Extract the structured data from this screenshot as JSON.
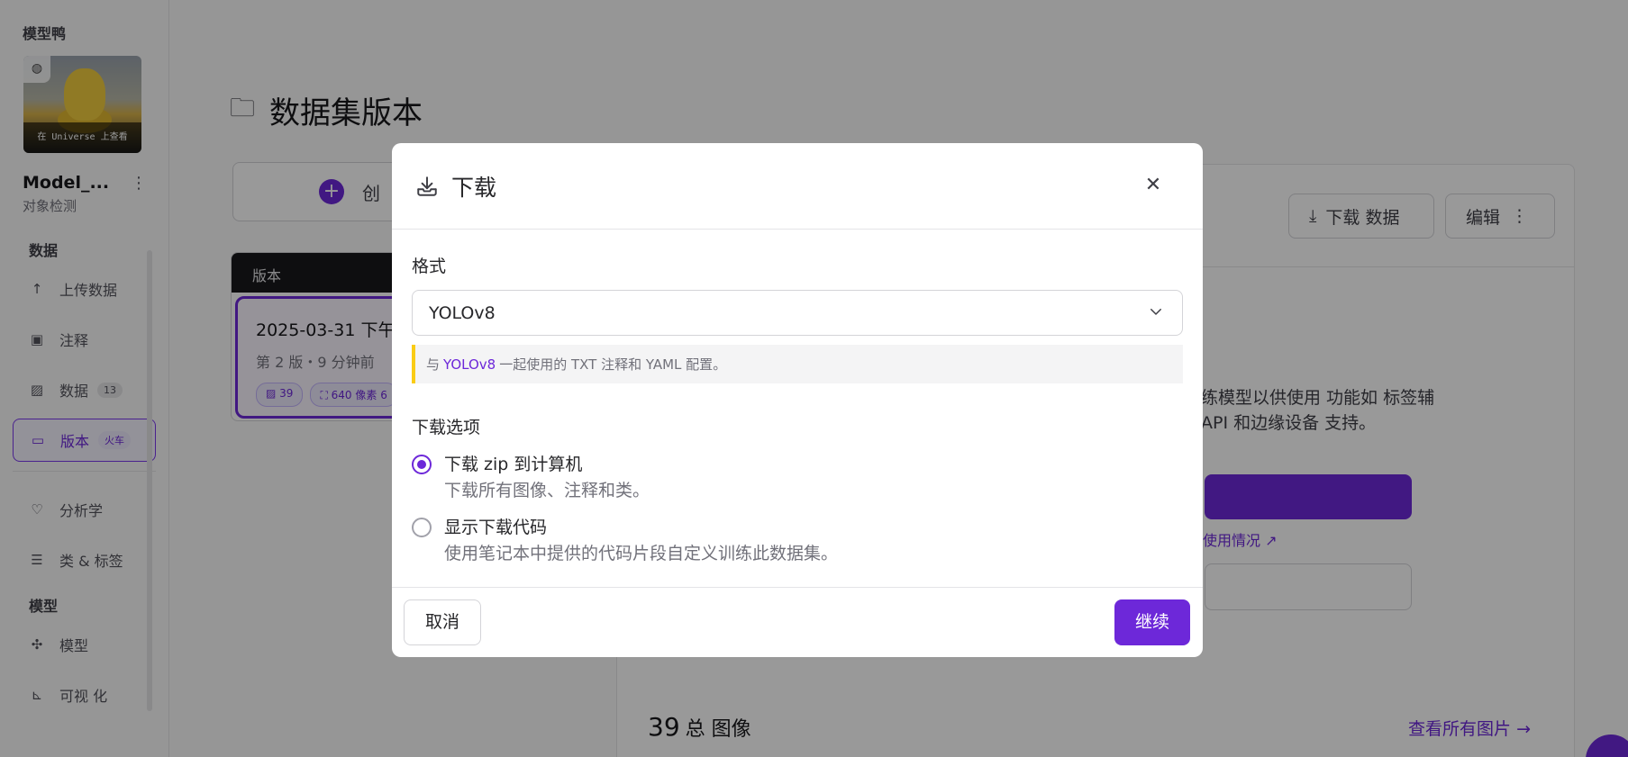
{
  "sidebar": {
    "brand": "模型鸭",
    "thumbnail_caption": "在 Universe 上查看",
    "project_name": "Model_...",
    "project_type": "对象检测",
    "sections": {
      "data": "数据",
      "model": "模型"
    },
    "items": [
      {
        "label": "上传数据",
        "icon": "upload-icon"
      },
      {
        "label": "注释",
        "icon": "annotate-icon"
      },
      {
        "label": "数据",
        "icon": "image-icon",
        "badge": "13"
      },
      {
        "label": "版本",
        "icon": "folder-icon",
        "badge": "火车",
        "active": true
      },
      {
        "label": "分析学",
        "icon": "heart-pulse-icon"
      },
      {
        "label": "类 & 标签",
        "icon": "list-icon"
      },
      {
        "label": "模型",
        "icon": "graph-icon"
      },
      {
        "label": "可视 化",
        "icon": "chart-icon"
      }
    ]
  },
  "main": {
    "title": "数据集版本",
    "create_label": "创",
    "versions_header": "版本",
    "version": {
      "date": "2025-03-31 下午",
      "subtitle": "第 2 版・9 分钟前",
      "chip_images": "39",
      "chip_size": "640 像素 6"
    },
    "detail": {
      "download_button": "下载 数据",
      "edit_button": "编辑",
      "text_line1": "练模型以供使用 功能如 标签辅",
      "text_line2": "API 和边缘设备 支持。",
      "usage_link": "使用情况",
      "total_count": "39",
      "total_label": "总 图像",
      "view_all": "查看所有图片"
    }
  },
  "modal": {
    "title": "下载",
    "format_label": "格式",
    "format_value": "YOLOv8",
    "hint_prefix": "与",
    "hint_accent": "YOLOv8",
    "hint_suffix": "一起使用的 TXT 注释和 YAML 配置。",
    "options_label": "下载选项",
    "options": [
      {
        "title": "下载 zip 到计算机",
        "desc": "下载所有图像、注释和类。",
        "selected": true
      },
      {
        "title": "显示下载代码",
        "desc": "使用笔记本中提供的代码片段自定义训练此数据集。",
        "selected": false
      }
    ],
    "cancel": "取消",
    "continue": "继续"
  },
  "colors": {
    "accent": "#6d28d9",
    "hint_border": "#facc15",
    "overlay": "rgba(0,0,0,0.40)"
  }
}
